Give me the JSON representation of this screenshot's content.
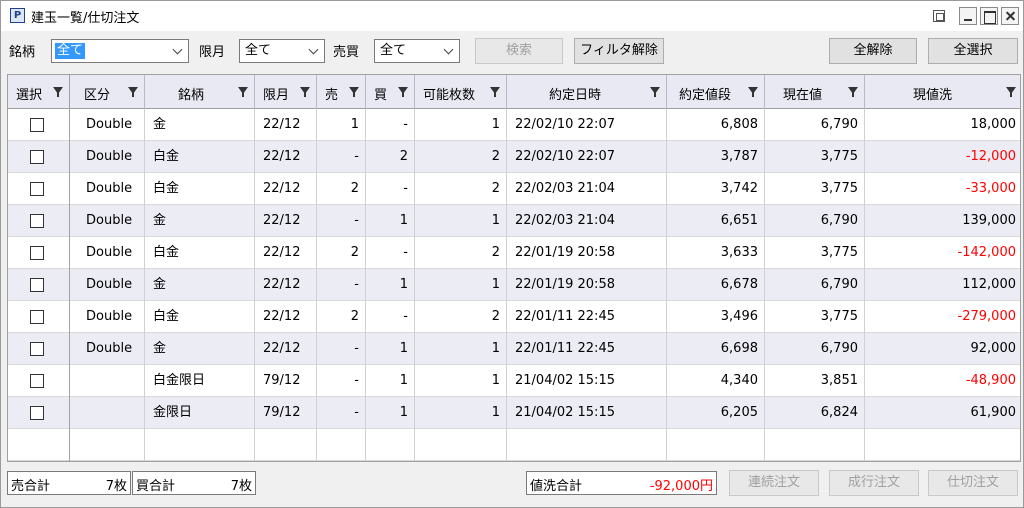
{
  "window": {
    "title": "建玉一覧/仕切注文",
    "app_icon": "P"
  },
  "toolbar": {
    "brand_label": "銘柄",
    "brand_value": "全て",
    "month_label": "限月",
    "month_value": "全て",
    "side_label": "売買",
    "side_value": "全て",
    "search_button": "検索",
    "filter_clear_button": "フィルタ解除",
    "deselect_all_button": "全解除",
    "select_all_button": "全選択"
  },
  "table": {
    "columns": [
      "選択",
      "区分",
      "銘柄",
      "限月",
      "売",
      "買",
      "可能枚数",
      "約定日時",
      "約定値段",
      "現在値",
      "現値洗"
    ],
    "rows": [
      {
        "type": "Double",
        "brand": "金",
        "month": "22/12",
        "sell": "1",
        "buy": "-",
        "qty": "1",
        "datetime": "22/02/10 22:07",
        "price": "6,808",
        "current": "6,790",
        "pl": "18,000"
      },
      {
        "type": "Double",
        "brand": "白金",
        "month": "22/12",
        "sell": "-",
        "buy": "2",
        "qty": "2",
        "datetime": "22/02/10 22:07",
        "price": "3,787",
        "current": "3,775",
        "pl": "-12,000"
      },
      {
        "type": "Double",
        "brand": "白金",
        "month": "22/12",
        "sell": "2",
        "buy": "-",
        "qty": "2",
        "datetime": "22/02/03 21:04",
        "price": "3,742",
        "current": "3,775",
        "pl": "-33,000"
      },
      {
        "type": "Double",
        "brand": "金",
        "month": "22/12",
        "sell": "-",
        "buy": "1",
        "qty": "1",
        "datetime": "22/02/03 21:04",
        "price": "6,651",
        "current": "6,790",
        "pl": "139,000"
      },
      {
        "type": "Double",
        "brand": "白金",
        "month": "22/12",
        "sell": "2",
        "buy": "-",
        "qty": "2",
        "datetime": "22/01/19 20:58",
        "price": "3,633",
        "current": "3,775",
        "pl": "-142,000"
      },
      {
        "type": "Double",
        "brand": "金",
        "month": "22/12",
        "sell": "-",
        "buy": "1",
        "qty": "1",
        "datetime": "22/01/19 20:58",
        "price": "6,678",
        "current": "6,790",
        "pl": "112,000"
      },
      {
        "type": "Double",
        "brand": "白金",
        "month": "22/12",
        "sell": "2",
        "buy": "-",
        "qty": "2",
        "datetime": "22/01/11 22:45",
        "price": "3,496",
        "current": "3,775",
        "pl": "-279,000"
      },
      {
        "type": "Double",
        "brand": "金",
        "month": "22/12",
        "sell": "-",
        "buy": "1",
        "qty": "1",
        "datetime": "22/01/11 22:45",
        "price": "6,698",
        "current": "6,790",
        "pl": "92,000"
      },
      {
        "type": "",
        "brand": "白金限日",
        "month": "79/12",
        "sell": "-",
        "buy": "1",
        "qty": "1",
        "datetime": "21/04/02 15:15",
        "price": "4,340",
        "current": "3,851",
        "pl": "-48,900"
      },
      {
        "type": "",
        "brand": "金限日",
        "month": "79/12",
        "sell": "-",
        "buy": "1",
        "qty": "1",
        "datetime": "21/04/02 15:15",
        "price": "6,205",
        "current": "6,824",
        "pl": "61,900"
      }
    ]
  },
  "footer": {
    "sell_total_label": "売合計",
    "sell_total_value": "7枚",
    "buy_total_label": "買合計",
    "buy_total_value": "7枚",
    "pl_total_label": "値洗合計",
    "pl_total_value": "-92,000円",
    "consecutive_order_button": "連続注文",
    "market_order_button": "成行注文",
    "close_order_button": "仕切注文"
  },
  "colors": {
    "negative": "#ff0000",
    "selection": "#3399ff",
    "header_bg": "#e9e9f4",
    "alt_row_bg": "#ececf4"
  }
}
